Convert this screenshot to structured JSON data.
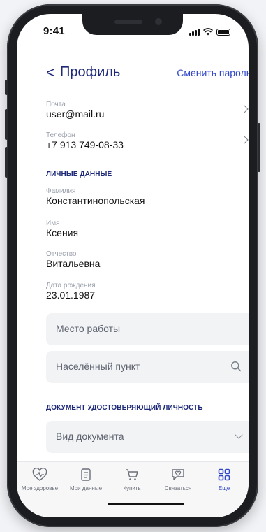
{
  "status_bar": {
    "time": "9:41"
  },
  "header": {
    "back_glyph": "<",
    "title": "Профиль",
    "change_password": "Сменить пароль"
  },
  "contacts": [
    {
      "label": "Почта",
      "value": "user@mail.ru"
    },
    {
      "label": "Телефон",
      "value": "+7 913 749-08-33"
    }
  ],
  "personal_section": {
    "title": "ЛИЧНЫЕ ДАННЫЕ",
    "fields": [
      {
        "label": "Фамилия",
        "value": "Константинопольская"
      },
      {
        "label": "Имя",
        "value": "Ксения"
      },
      {
        "label": "Отчество",
        "value": "Витальевна"
      },
      {
        "label": "Дата рождения",
        "value": "23.01.1987"
      }
    ],
    "workplace_placeholder": "Место работы",
    "settlement_placeholder": "Населённый пункт"
  },
  "document_section": {
    "title": "ДОКУМЕНТ УДОСТОВЕРЯЮЩИЙ ЛИЧНОСТЬ",
    "doc_type_placeholder": "Вид документа"
  },
  "tabbar": {
    "items": [
      {
        "label": "Мое здоровье",
        "icon": "heart-pulse-icon"
      },
      {
        "label": "Мои данные",
        "icon": "document-icon"
      },
      {
        "label": "Купить",
        "icon": "cart-icon"
      },
      {
        "label": "Связаться",
        "icon": "chat-heart-icon"
      },
      {
        "label": "Еще",
        "icon": "grid-icon"
      }
    ],
    "active_color": "#2f47c7",
    "inactive_color": "#6a6f78"
  },
  "colors": {
    "title": "#1e2a78",
    "link": "#2f47c7",
    "input_bg": "#f2f3f5"
  }
}
